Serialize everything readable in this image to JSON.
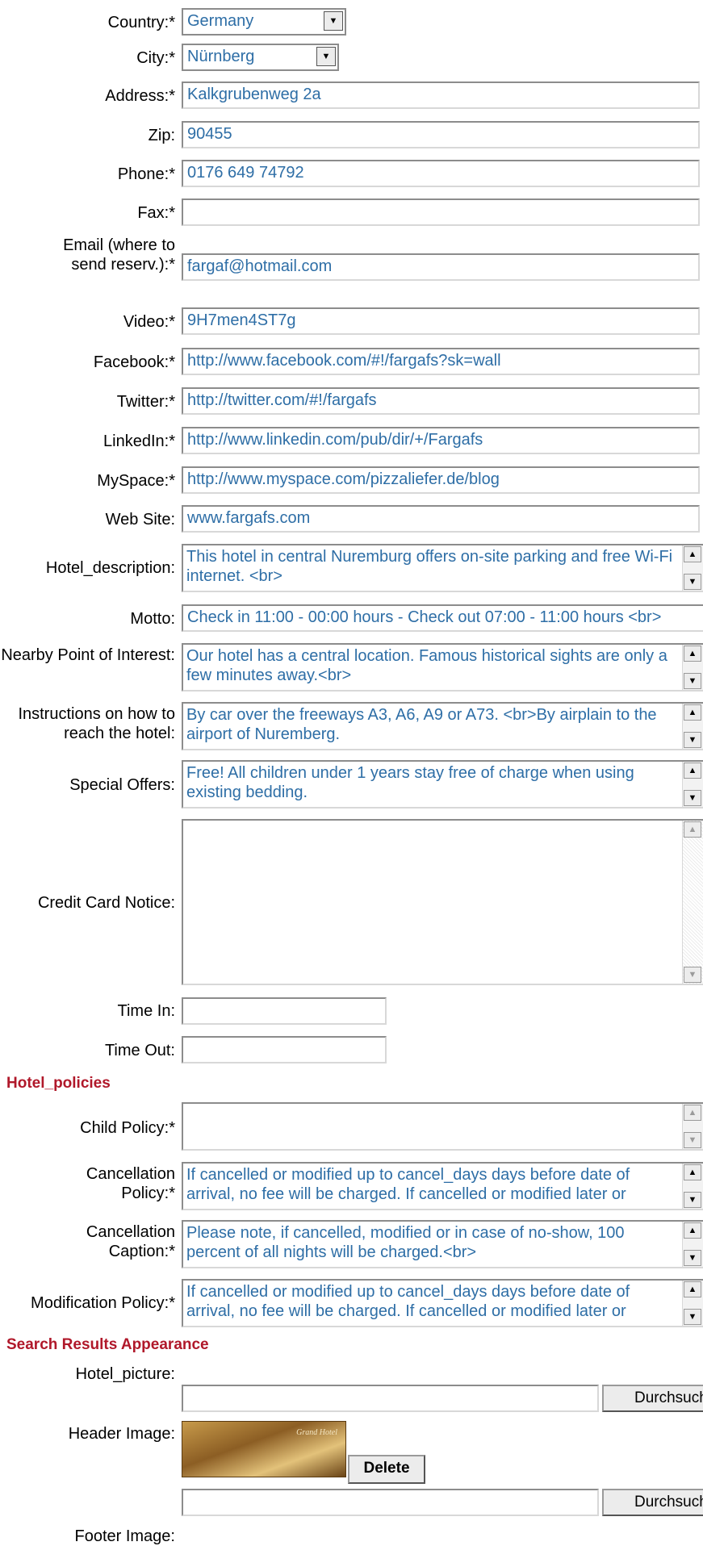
{
  "fields": {
    "country": {
      "label": "Country:*",
      "value": "Germany"
    },
    "city": {
      "label": "City:*",
      "value": "Nürnberg"
    },
    "address": {
      "label": "Address:*",
      "value": "Kalkgrubenweg 2a"
    },
    "zip": {
      "label": "Zip:",
      "value": "90455"
    },
    "phone": {
      "label": "Phone:*",
      "value": "0176 649 74792"
    },
    "fax": {
      "label": "Fax:*",
      "value": ""
    },
    "email": {
      "label": "Email (where to send reserv.):*",
      "value": "fargaf@hotmail.com"
    },
    "video": {
      "label": "Video:*",
      "value": "9H7men4ST7g"
    },
    "facebook": {
      "label": "Facebook:*",
      "value": "http://www.facebook.com/#!/fargafs?sk=wall"
    },
    "twitter": {
      "label": "Twitter:*",
      "value": "http://twitter.com/#!/fargafs"
    },
    "linkedin": {
      "label": "LinkedIn:*",
      "value": "http://www.linkedin.com/pub/dir/+/Fargafs"
    },
    "myspace": {
      "label": "MySpace:*",
      "value": "http://www.myspace.com/pizzaliefer.de/blog"
    },
    "website": {
      "label": "Web Site:",
      "value": "www.fargafs.com"
    },
    "hotel_description": {
      "label": "Hotel_description:",
      "value": "This hotel in central Nuremburg offers on-site parking and free Wi-Fi internet. <br>"
    },
    "motto": {
      "label": "Motto:",
      "value": "Check in 11:00 - 00:00 hours - Check out  07:00 - 11:00 hours <br>"
    },
    "nearby": {
      "label": "Nearby Point of Interest:",
      "value": "Our hotel has a central location. Famous historical sights are only a few minutes away.<br>"
    },
    "instructions": {
      "label": "Instructions on how to reach the hotel:",
      "value": "By car over the freeways A3, A6, A9 or A73. <br>By airplain to the airport of Nuremberg."
    },
    "special_offers": {
      "label": "Special Offers:",
      "value": "Free! All children under 1 years stay free of charge when using existing bedding."
    },
    "credit_card_notice": {
      "label": "Credit Card Notice:",
      "value": ""
    },
    "time_in": {
      "label": "Time In:",
      "value": ""
    },
    "time_out": {
      "label": "Time Out:",
      "value": ""
    }
  },
  "policies": {
    "heading": "Hotel_policies",
    "child": {
      "label": "Child Policy:*",
      "value": ""
    },
    "cancellation": {
      "label": "Cancellation Policy:*",
      "value": "If cancelled or modified up to cancel_days days before date of arrival, no fee will be charged. If cancelled or modified later or"
    },
    "cancellation_caption": {
      "label": "Cancellation Caption:*",
      "value": "Please note, if cancelled, modified or in case of no-show, 100 percent of all nights will be charged.<br>"
    },
    "modification": {
      "label": "Modification Policy:*",
      "value": "If cancelled or modified up to cancel_days days before date of arrival, no fee will be charged. If cancelled or modified later or"
    }
  },
  "search_results": {
    "heading": "Search Results Appearance",
    "hotel_picture": {
      "label": "Hotel_picture:",
      "file_value": "",
      "browse_label": "Durchsuchen..."
    },
    "header_image": {
      "label": "Header Image:",
      "logo_text": "Grand Hotel",
      "delete_label": "Delete",
      "file_value": "",
      "browse_label": "Durchsuchen..."
    },
    "footer_image": {
      "label": "Footer Image:"
    }
  }
}
